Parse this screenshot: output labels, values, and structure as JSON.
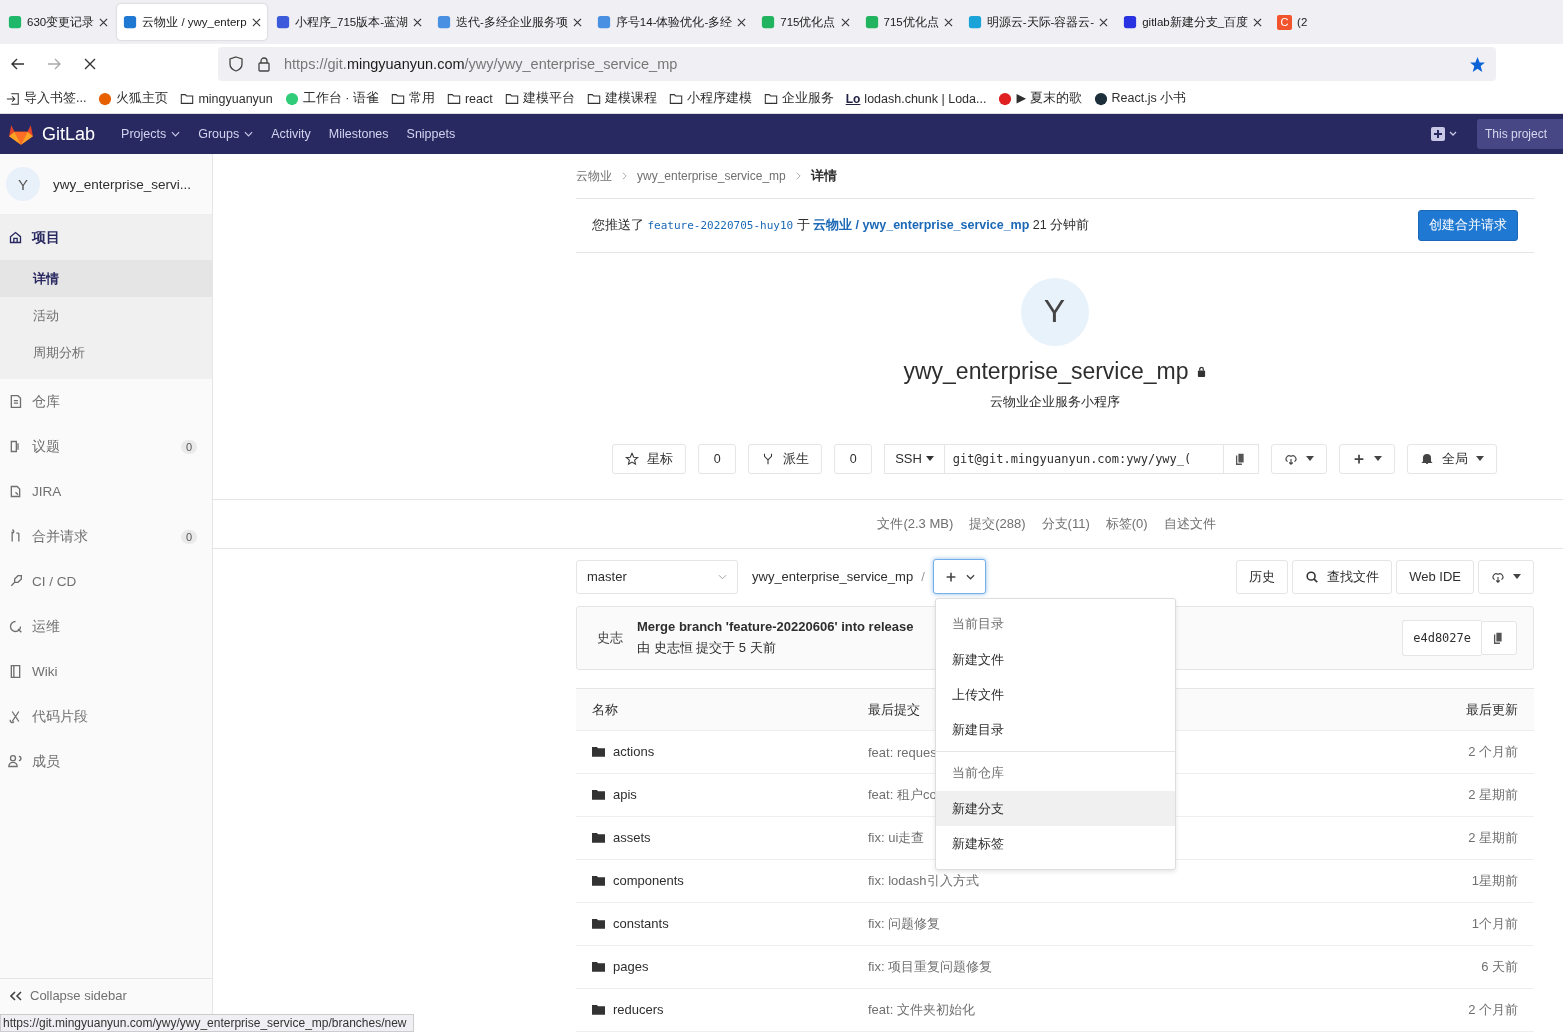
{
  "browser": {
    "tabs": [
      {
        "label": "630变更记录",
        "selected": false,
        "color": "#1fb86b"
      },
      {
        "label": "云物业 / ywy_enterp",
        "selected": true,
        "color": "#1f78d1"
      },
      {
        "label": "小程序_715版本-蓝湖",
        "selected": false,
        "color": "#3b5bdb"
      },
      {
        "label": "迭代-多经企业服务项",
        "selected": false,
        "color": "#4a90e2"
      },
      {
        "label": "序号14-体验优化-多经",
        "selected": false,
        "color": "#4a90e2"
      },
      {
        "label": "715优化点",
        "selected": false,
        "color": "#22b35e"
      },
      {
        "label": "715优化点",
        "selected": false,
        "color": "#22b35e"
      },
      {
        "label": "明源云-天际-容器云-",
        "selected": false,
        "color": "#1aa3d9"
      },
      {
        "label": "gitlab新建分支_百度",
        "selected": false,
        "color": "#2932e1"
      },
      {
        "label": "(2",
        "selected": false,
        "color": "#f2542d",
        "icon_text": "C"
      }
    ],
    "url": {
      "prefix": "https://git.",
      "domain": "mingyuanyun.com",
      "path": "/ywy/ywy_enterprise_service_mp"
    },
    "bookmarks": [
      {
        "label": "导入书签...",
        "kind": "import"
      },
      {
        "label": "火狐主页",
        "kind": "site",
        "color": "#e66000"
      },
      {
        "label": "mingyuanyun",
        "kind": "folder"
      },
      {
        "label": "工作台 · 语雀",
        "kind": "site",
        "color": "#31cc79"
      },
      {
        "label": "常用",
        "kind": "folder"
      },
      {
        "label": "react",
        "kind": "folder"
      },
      {
        "label": "建模平台",
        "kind": "folder"
      },
      {
        "label": "建模课程",
        "kind": "folder"
      },
      {
        "label": "小程序建模",
        "kind": "folder"
      },
      {
        "label": "企业服务",
        "kind": "folder"
      },
      {
        "label": "lodash.chunk | Loda...",
        "kind": "text",
        "icon_text": "Lo"
      },
      {
        "label": "▶ 夏末的歌",
        "kind": "site",
        "color": "#e02020"
      },
      {
        "label": "React.js 小书",
        "kind": "site",
        "color": "#1d2f3a"
      }
    ],
    "status_url": "https://git.mingyuanyun.com/ywy/ywy_enterprise_service_mp/branches/new"
  },
  "header": {
    "brand": "GitLab",
    "nav": [
      {
        "label": "Projects",
        "dropdown": true
      },
      {
        "label": "Groups",
        "dropdown": true
      },
      {
        "label": "Activity",
        "dropdown": false
      },
      {
        "label": "Milestones",
        "dropdown": false
      },
      {
        "label": "Snippets",
        "dropdown": false
      }
    ],
    "search": {
      "placeholder": "This project"
    }
  },
  "sidebar": {
    "project": {
      "avatar": "Y",
      "name": "ywy_enterprise_servi..."
    },
    "items": [
      {
        "label": "项目",
        "selected": true,
        "children": [
          {
            "label": "详情",
            "selected": true
          },
          {
            "label": "活动",
            "selected": false
          },
          {
            "label": "周期分析",
            "selected": false
          }
        ]
      },
      {
        "label": "仓库",
        "selected": false
      },
      {
        "label": "议题",
        "selected": false,
        "count": "0"
      },
      {
        "label": "JIRA",
        "selected": false
      },
      {
        "label": "合并请求",
        "selected": false,
        "count": "0"
      },
      {
        "label": "CI / CD",
        "selected": false
      },
      {
        "label": "运维",
        "selected": false
      },
      {
        "label": "Wiki",
        "selected": false
      },
      {
        "label": "代码片段",
        "selected": false
      },
      {
        "label": "成员",
        "selected": false
      }
    ],
    "collapse": "Collapse sidebar"
  },
  "breadcrumb": [
    "云物业",
    "ywy_enterprise_service_mp",
    "详情"
  ],
  "push_alert": {
    "prefix": "您推送了",
    "branch": "feature-20220705-huy10",
    "middle": "于",
    "project": "云物业 / ywy_enterprise_service_mp",
    "time": "21 分钟前",
    "button": "创建合并请求"
  },
  "project": {
    "avatar": "Y",
    "name": "ywy_enterprise_service_mp",
    "private": true,
    "description": "云物业企业服务小程序",
    "star": {
      "label": "星标",
      "count": "0"
    },
    "fork": {
      "label": "派生",
      "count": "0"
    },
    "protocol": "SSH",
    "clone_url": "git@git.mingyuanyun.com:ywy/ywy_(",
    "notification": "全局"
  },
  "stats": [
    "文件(2.3 MB)",
    "提交(288)",
    "分支(11)",
    "标签(0)",
    "自述文件"
  ],
  "tree": {
    "branch": "master",
    "path": "ywy_enterprise_service_mp",
    "separator": "/",
    "buttons": [
      "历史",
      "查找文件",
      "Web IDE"
    ]
  },
  "last_commit": {
    "avatar": "史志",
    "message": "Merge branch 'feature-20220606' into release",
    "byline": "由 史志恒 提交于 5 天前",
    "sha": "e4d8027e"
  },
  "files": {
    "columns": [
      "名称",
      "最后提交",
      "最后更新"
    ],
    "rows": [
      {
        "name": "actions",
        "commit": "feat: reques",
        "updated": "2 个月前"
      },
      {
        "name": "apis",
        "commit": "feat: 租户co",
        "updated": "2 星期前"
      },
      {
        "name": "assets",
        "commit": "fix: ui走查",
        "updated": "2 星期前"
      },
      {
        "name": "components",
        "commit": "fix: lodash引入方式",
        "updated": "1星期前"
      },
      {
        "name": "constants",
        "commit": "fix: 问题修复",
        "updated": "1个月前"
      },
      {
        "name": "pages",
        "commit": "fix: 项目重复问题修复",
        "updated": "6 天前"
      },
      {
        "name": "reducers",
        "commit": "feat: 文件夹初始化",
        "updated": "2 个月前"
      }
    ]
  },
  "add_menu": {
    "open": true,
    "sections": [
      {
        "header": "当前目录",
        "items": [
          {
            "label": "新建文件",
            "selected": false
          },
          {
            "label": "上传文件",
            "selected": false
          },
          {
            "label": "新建目录",
            "selected": false
          }
        ]
      },
      {
        "header": "当前仓库",
        "items": [
          {
            "label": "新建分支",
            "selected": true
          },
          {
            "label": "新建标签",
            "selected": false
          }
        ]
      }
    ]
  }
}
